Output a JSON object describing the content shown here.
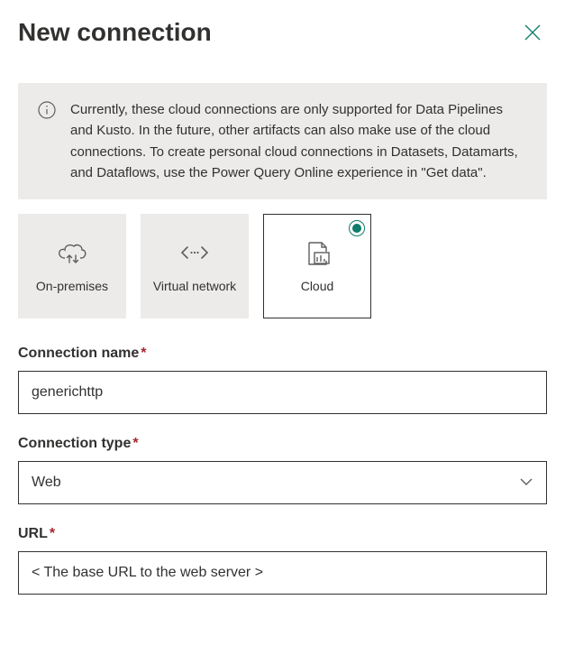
{
  "header": {
    "title": "New connection"
  },
  "info": {
    "text": "Currently, these cloud connections are only supported for Data Pipelines and Kusto. In the future, other artifacts can also make use of the cloud connections. To create personal cloud connections in Datasets, Datamarts, and Dataflows, use the Power Query Online experience in \"Get data\"."
  },
  "connectionTypes": {
    "onprem": "On-premises",
    "vnet": "Virtual network",
    "cloud": "Cloud",
    "selected": "cloud"
  },
  "fields": {
    "name": {
      "label": "Connection name",
      "value": "generichttp"
    },
    "type": {
      "label": "Connection type",
      "value": "Web"
    },
    "url": {
      "label": "URL",
      "value": "< The base URL to the web server >"
    }
  },
  "colors": {
    "accent": "#107c6c",
    "required": "#a4262c",
    "neutralBg": "#edebe9"
  }
}
